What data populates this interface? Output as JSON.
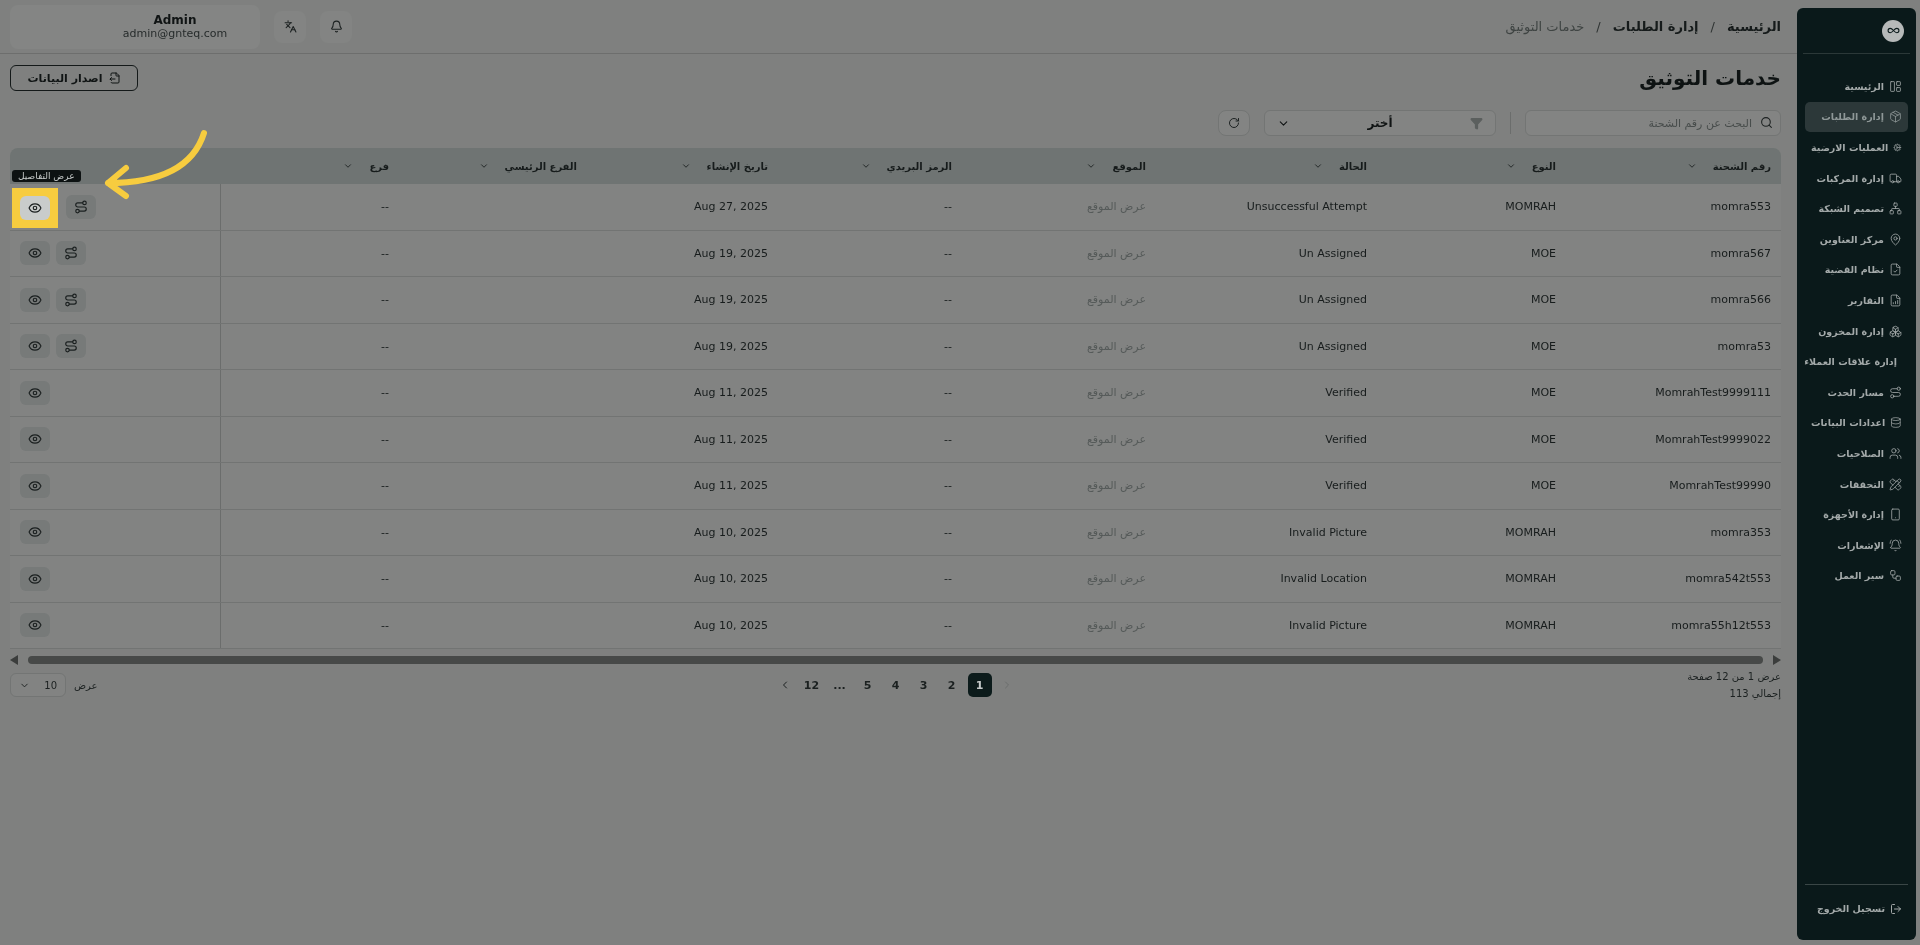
{
  "header": {
    "user": {
      "name": "Admin",
      "email": "admin@gnteq.com"
    },
    "breadcrumb": [
      {
        "label": "الرئيسية",
        "current": false
      },
      {
        "label": "إدارة الطلبات",
        "current": false
      },
      {
        "label": "خدمات التوثيق",
        "current": true
      }
    ],
    "separator": "/"
  },
  "page": {
    "title": "خدمات التوثيق",
    "export_button": "اصدار البيانات"
  },
  "toolbar": {
    "search": {
      "placeholder": "البحث عن رقم الشحنة"
    },
    "filter": {
      "value": "أختر"
    }
  },
  "table": {
    "columns": [
      "رقم الشحنة",
      "النوع",
      "الحالة",
      "الموقع",
      "الرمز البريدي",
      "تاريخ الإنشاء",
      "الفرع الرئيسي",
      "فرع"
    ],
    "rows": [
      {
        "cells": [
          "momra553",
          "MOMRAH",
          "Unsuccessful Attempt",
          "عرض الموقع",
          "--",
          "Aug 27, 2025",
          null,
          "--"
        ],
        "actions": [
          {
            "kind": "view"
          },
          {
            "kind": "route"
          }
        ],
        "highlighted": true
      },
      {
        "cells": [
          "momra567",
          "MOE",
          "Un Assigned",
          "عرض الموقع",
          "--",
          "Aug 19, 2025",
          null,
          "--"
        ],
        "actions": [
          {
            "kind": "view"
          },
          {
            "kind": "route"
          }
        ],
        "highlighted": false
      },
      {
        "cells": [
          "momra566",
          "MOE",
          "Un Assigned",
          "عرض الموقع",
          "--",
          "Aug 19, 2025",
          null,
          "--"
        ],
        "actions": [
          {
            "kind": "view"
          },
          {
            "kind": "route"
          }
        ],
        "highlighted": false
      },
      {
        "cells": [
          "momra53",
          "MOE",
          "Un Assigned",
          "عرض الموقع",
          "--",
          "Aug 19, 2025",
          null,
          "--"
        ],
        "actions": [
          {
            "kind": "view"
          },
          {
            "kind": "route"
          }
        ],
        "highlighted": false
      },
      {
        "cells": [
          "MomrahTest9999111",
          "MOE",
          "Verified",
          "عرض الموقع",
          "--",
          "Aug 11, 2025",
          null,
          "--"
        ],
        "actions": [
          {
            "kind": "view"
          }
        ],
        "highlighted": false
      },
      {
        "cells": [
          "MomrahTest9999022",
          "MOE",
          "Verified",
          "عرض الموقع",
          "--",
          "Aug 11, 2025",
          null,
          "--"
        ],
        "actions": [
          {
            "kind": "view"
          }
        ],
        "highlighted": false
      },
      {
        "cells": [
          "MomrahTest99990",
          "MOE",
          "Verified",
          "عرض الموقع",
          "--",
          "Aug 11, 2025",
          null,
          "--"
        ],
        "actions": [
          {
            "kind": "view"
          }
        ],
        "highlighted": false
      },
      {
        "cells": [
          "momra353",
          "MOMRAH",
          "Invalid Picture",
          "عرض الموقع",
          "--",
          "Aug 10, 2025",
          null,
          "--"
        ],
        "actions": [
          {
            "kind": "view"
          }
        ],
        "highlighted": false
      },
      {
        "cells": [
          "momra542t553",
          "MOMRAH",
          "Invalid Location",
          "عرض الموقع",
          "--",
          "Aug 10, 2025",
          null,
          "--"
        ],
        "actions": [
          {
            "kind": "view"
          }
        ],
        "highlighted": false
      },
      {
        "cells": [
          "momra55h12t553",
          "MOMRAH",
          "Invalid Picture",
          "عرض الموقع",
          "--",
          "Aug 10, 2025",
          null,
          "--"
        ],
        "actions": [
          {
            "kind": "view"
          }
        ],
        "highlighted": false
      }
    ]
  },
  "tour": {
    "tooltip": "عرض التفاصيل"
  },
  "pagination": {
    "summary": "عرض 1 من 12 صفحة",
    "total": "إجمالي 113",
    "pages": [
      {
        "label": "1",
        "selected": true
      },
      {
        "label": "2",
        "selected": false
      },
      {
        "label": "3",
        "selected": false
      },
      {
        "label": "4",
        "selected": false
      },
      {
        "label": "5",
        "selected": false
      },
      {
        "label": "...",
        "selected": false
      },
      {
        "label": "12",
        "selected": false
      }
    ],
    "prev_disabled": true,
    "page_size_label": "عرض",
    "page_size": "10"
  },
  "sidebar": {
    "items": [
      {
        "label": "الرئيسية",
        "selected": false
      },
      {
        "label": "إدارة الطلبات",
        "selected": true
      },
      {
        "label": "العمليات الارضية",
        "selected": false
      },
      {
        "label": "إدارة المركبات",
        "selected": false
      },
      {
        "label": "تصميم الشبكة",
        "selected": false
      },
      {
        "label": "مركز العناوين",
        "selected": false
      },
      {
        "label": "نظام القضية",
        "selected": false
      },
      {
        "label": "التقارير",
        "selected": false
      },
      {
        "label": "إدارة المخزون",
        "selected": false
      },
      {
        "label": "إدارة علاقات العملاء",
        "selected": false
      },
      {
        "label": "مسار الحدث",
        "selected": false
      },
      {
        "label": "اعدادات البيانات",
        "selected": false
      },
      {
        "label": "الصلاحيات",
        "selected": false
      },
      {
        "label": "التحققات",
        "selected": false
      },
      {
        "label": "إدارة الأجهزة",
        "selected": false
      },
      {
        "label": "الإشعارات",
        "selected": false
      },
      {
        "label": "سير العمل",
        "selected": false
      }
    ],
    "logout": "تسجيل الخروج"
  }
}
